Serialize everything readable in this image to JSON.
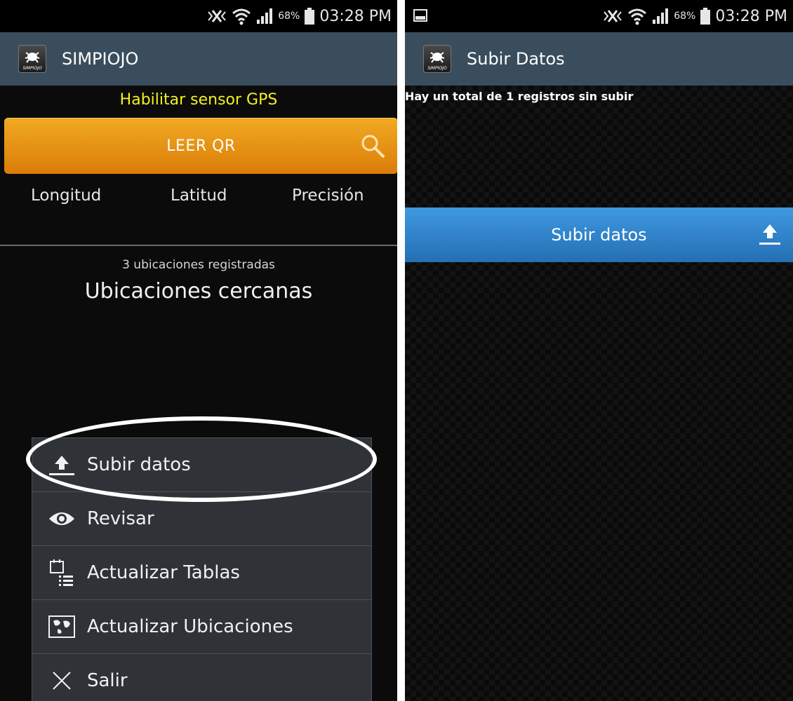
{
  "status_bar": {
    "battery_percent": "68%",
    "time": "03:28 PM",
    "icons": [
      "mute-vibrate-icon",
      "wifi-icon",
      "signal-icon",
      "battery-icon"
    ],
    "right_extra_icon": "gallery-notification-icon"
  },
  "main_screen": {
    "app_title": "SIMPIOJO",
    "logo_text": "SIMPIOJO",
    "gps_link": "Habilitar sensor GPS",
    "qr_button": "LEER QR",
    "columns": [
      "Longitud",
      "Latitud",
      "Precisión"
    ],
    "registered_count": "3 ubicaciones registradas",
    "nearby_title": "Ubicaciones cercanas",
    "menu": [
      {
        "label": "Subir datos",
        "icon": "upload-icon"
      },
      {
        "label": "Revisar",
        "icon": "eye-icon"
      },
      {
        "label": "Actualizar Tablas",
        "icon": "table-list-icon"
      },
      {
        "label": "Actualizar Ubicaciones",
        "icon": "map-icon"
      },
      {
        "label": "Salir",
        "icon": "close-icon"
      }
    ]
  },
  "upload_screen": {
    "title": "Subir Datos",
    "records_text_pre": "Hay un total de",
    "records_count": "1",
    "records_text_post": "registros sin subir",
    "upload_button": "Subir datos"
  },
  "colors": {
    "action_bar": "#3a4d5c",
    "gps_link": "#f3f11d",
    "qr_button": "#e89114",
    "upload_button": "#2f86cc",
    "menu_bg": "#2f3338"
  }
}
